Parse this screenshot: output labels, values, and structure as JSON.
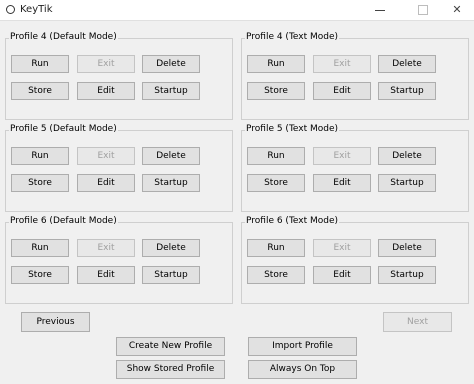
{
  "window": {
    "title": "KeyTik",
    "minimize": "",
    "maximize": "",
    "close": "✕"
  },
  "groups": [
    {
      "label": "Profile 4 (Default Mode)"
    },
    {
      "label": "Profile 4 (Text Mode)"
    },
    {
      "label": "Profile 5 (Default Mode)"
    },
    {
      "label": "Profile 5 (Text Mode)"
    },
    {
      "label": "Profile 6 (Default Mode)"
    },
    {
      "label": "Profile 6 (Text Mode)"
    }
  ],
  "buttons": {
    "run": "Run",
    "exit": "Exit",
    "delete": "Delete",
    "store": "Store",
    "edit": "Edit",
    "startup": "Startup"
  },
  "nav": {
    "previous": "Previous",
    "next": "Next"
  },
  "actions": {
    "create": "Create New Profile",
    "import": "Import Profile",
    "show_stored": "Show Stored Profile",
    "always_on_top": "Always On Top"
  }
}
